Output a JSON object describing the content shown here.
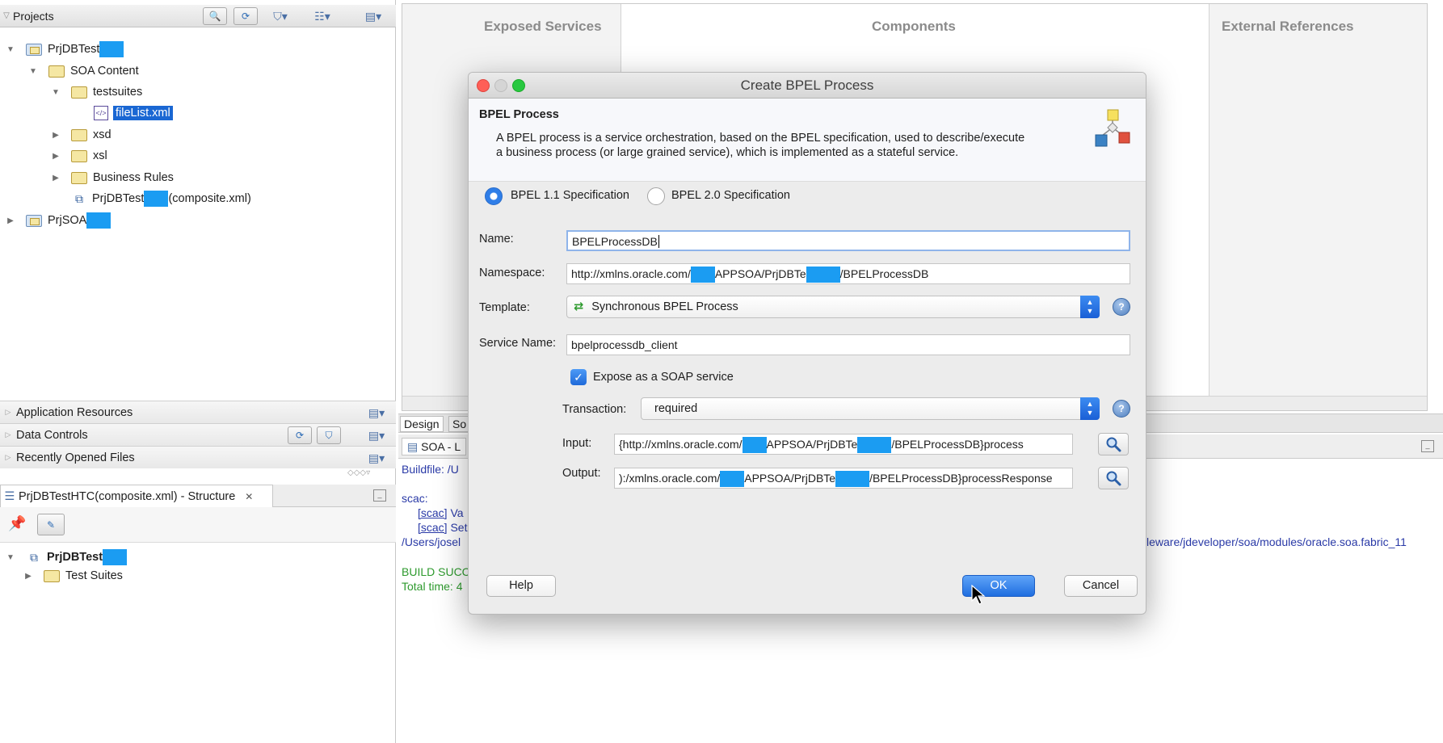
{
  "left": {
    "projects_header": "Projects",
    "tree": {
      "project1": "PrjDBTest",
      "soa_content": "SOA Content",
      "testsuites": "testsuites",
      "filelist": "fileList.xml",
      "xsd": "xsd",
      "xsl": "xsl",
      "business_rules": "Business Rules",
      "composite_prefix": "PrjDBTest",
      "composite_suffix": "(composite.xml)",
      "project2": "PrjSOA"
    },
    "accordion": {
      "app_resources": "Application Resources",
      "data_controls": "Data Controls",
      "recent_files": "Recently Opened Files"
    },
    "structure": {
      "tab_title": "PrjDBTestHTC(composite.xml) - Structure",
      "close": "✕",
      "root": "PrjDBTest",
      "test_suites": "Test Suites"
    }
  },
  "main": {
    "columns": {
      "exposed": "Exposed Services",
      "components": "Components",
      "external": "External References"
    },
    "tabs": {
      "design": "Design",
      "source": "So"
    },
    "log": {
      "tab": "SOA - L",
      "buildfile": "Buildfile: /U",
      "scac": "scac:",
      "line1_tag": "[scac]",
      "line1_text": "Va",
      "line2_tag": "[scac]",
      "line2_text": "Set",
      "path": "/Users/josel",
      "path_right": "leware/jdeveloper/soa/modules/oracle.soa.fabric_11",
      "build": "BUILD SUCC",
      "total": "Total time: 4"
    }
  },
  "dialog": {
    "title": "Create BPEL Process",
    "header_title": "BPEL Process",
    "description": "A BPEL process is a service orchestration, based on the BPEL specification, used to describe/execute a business process (or large grained service), which is implemented as a stateful service.",
    "radio_11": "BPEL 1.1 Specification",
    "radio_20": "BPEL 2.0 Specification",
    "name_label": "Name:",
    "name_value": "BPELProcessDB",
    "namespace_label": "Namespace:",
    "namespace_a": "http://xmlns.oracle.com/",
    "namespace_b": "APPSOA/PrjDBTe",
    "namespace_c": "/BPELProcessDB",
    "template_label": "Template:",
    "template_value": "Synchronous BPEL Process",
    "service_label": "Service Name:",
    "service_value": "bpelprocessdb_client",
    "expose_label": "Expose as a SOAP service",
    "transaction_label": "Transaction:",
    "transaction_value": "required",
    "input_label": "Input:",
    "input_a": "{http://xmlns.oracle.com/",
    "input_b": "APPSOA/PrjDBTe",
    "input_c": "/BPELProcessDB}process",
    "output_label": "Output:",
    "output_a": "):/xmlns.oracle.com/",
    "output_b": "APPSOA/PrjDBTe",
    "output_c": "/BPELProcessDB}processResponse",
    "help_btn": "Help",
    "ok_btn": "OK",
    "cancel_btn": "Cancel",
    "help_glyph": "?"
  }
}
